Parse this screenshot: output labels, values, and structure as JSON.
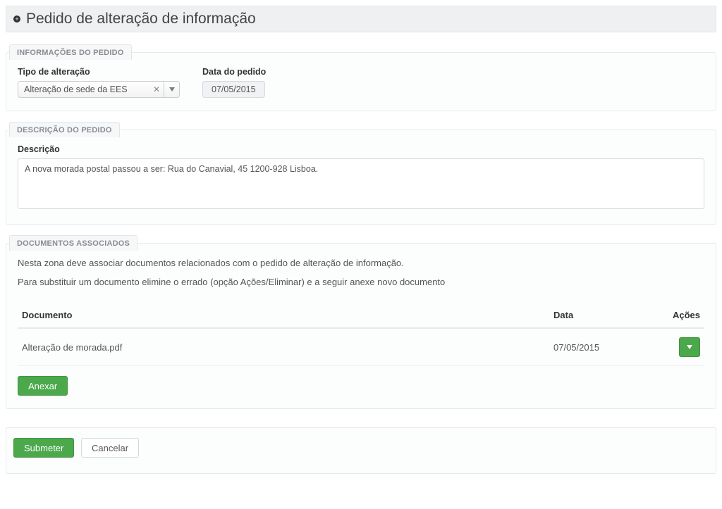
{
  "header": {
    "title": "Pedido de alteração de informação"
  },
  "info": {
    "tab_label": "INFORMAÇÕES DO PEDIDO",
    "type_label": "Tipo de alteração",
    "type_value": "Alteração de sede da EES",
    "date_label": "Data do pedido",
    "date_value": "07/05/2015"
  },
  "desc": {
    "tab_label": "DESCRIÇÃO DO PEDIDO",
    "field_label": "Descrição",
    "text": "A nova morada postal passou a ser: Rua do Canavial, 45 1200-928 Lisboa."
  },
  "docs": {
    "tab_label": "DOCUMENTOS ASSOCIADOS",
    "help1": "Nesta zona deve associar documentos relacionados com o pedido de alteração de informação.",
    "help2": "Para substituir um documento elimine o errado (opção Ações/Eliminar) e a seguir anexe novo documento",
    "col_doc": "Documento",
    "col_date": "Data",
    "col_actions": "Ações",
    "rows": [
      {
        "name": "Alteração de morada.pdf",
        "date": "07/05/2015"
      }
    ],
    "attach_label": "Anexar"
  },
  "footer": {
    "submit_label": "Submeter",
    "cancel_label": "Cancelar"
  }
}
